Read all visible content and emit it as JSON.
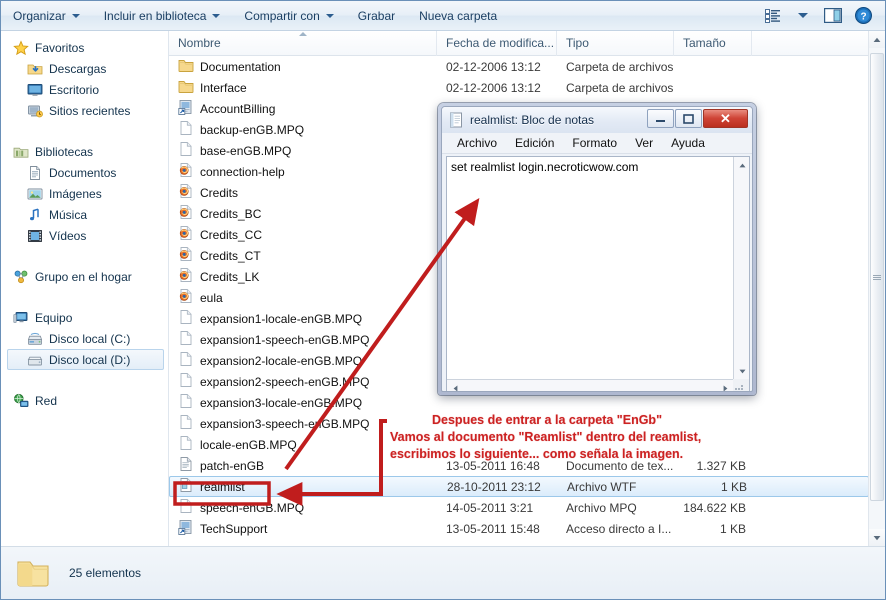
{
  "toolbar": {
    "items": [
      {
        "label": "Organizar",
        "caret": true,
        "name": "organize-button"
      },
      {
        "label": "Incluir en biblioteca",
        "caret": true,
        "name": "include-in-library-button"
      },
      {
        "label": "Compartir con",
        "caret": true,
        "name": "share-with-button"
      },
      {
        "label": "Grabar",
        "caret": false,
        "name": "burn-button"
      },
      {
        "label": "Nueva carpeta",
        "caret": false,
        "name": "new-folder-button"
      }
    ],
    "right_icons": [
      "view-options-icon",
      "chevron-down-icon",
      "preview-pane-icon",
      "help-icon"
    ]
  },
  "navpane": {
    "groups": [
      {
        "header": {
          "label": "Favoritos",
          "icon": "star-icon"
        },
        "items": [
          {
            "label": "Descargas",
            "icon": "downloads-folder-icon"
          },
          {
            "label": "Escritorio",
            "icon": "desktop-icon"
          },
          {
            "label": "Sitios recientes",
            "icon": "recent-places-icon"
          }
        ]
      },
      {
        "header": {
          "label": "Bibliotecas",
          "icon": "libraries-icon"
        },
        "items": [
          {
            "label": "Documentos",
            "icon": "documents-icon"
          },
          {
            "label": "Imágenes",
            "icon": "pictures-icon"
          },
          {
            "label": "Música",
            "icon": "music-icon"
          },
          {
            "label": "Vídeos",
            "icon": "videos-icon"
          }
        ]
      },
      {
        "header": {
          "label": "Grupo en el hogar",
          "icon": "homegroup-icon"
        },
        "items": []
      },
      {
        "header": {
          "label": "Equipo",
          "icon": "computer-icon"
        },
        "items": [
          {
            "label": "Disco local (C:)",
            "icon": "hard-disk-icon",
            "selected": false
          },
          {
            "label": "Disco local (D:)",
            "icon": "local-disk-icon",
            "selected": true
          }
        ]
      },
      {
        "header": {
          "label": "Red",
          "icon": "network-icon"
        },
        "items": []
      }
    ]
  },
  "columns": [
    {
      "label": "Nombre",
      "name": "column-header-name",
      "sorted": true
    },
    {
      "label": "Fecha de modifica...",
      "name": "column-header-date"
    },
    {
      "label": "Tipo",
      "name": "column-header-type"
    },
    {
      "label": "Tamaño",
      "name": "column-header-size"
    }
  ],
  "files": [
    {
      "name": "Documentation",
      "icon": "folder-icon",
      "date": "02-12-2006 13:12",
      "type": "Carpeta de archivos",
      "size": ""
    },
    {
      "name": "Interface",
      "icon": "folder-icon",
      "date": "02-12-2006 13:12",
      "type": "Carpeta de archivos",
      "size": ""
    },
    {
      "name": "AccountBilling",
      "icon": "shortcut-icon",
      "date": "",
      "type": "",
      "size": ""
    },
    {
      "name": "backup-enGB.MPQ",
      "icon": "blank-file-icon",
      "date": "",
      "type": "",
      "size": ""
    },
    {
      "name": "base-enGB.MPQ",
      "icon": "blank-file-icon",
      "date": "",
      "type": "",
      "size": ""
    },
    {
      "name": "connection-help",
      "icon": "firefox-html-icon",
      "date": "",
      "type": "",
      "size": ""
    },
    {
      "name": "Credits",
      "icon": "firefox-html-icon",
      "date": "",
      "type": "",
      "size": ""
    },
    {
      "name": "Credits_BC",
      "icon": "firefox-html-icon",
      "date": "",
      "type": "",
      "size": ""
    },
    {
      "name": "Credits_CC",
      "icon": "firefox-html-icon",
      "date": "",
      "type": "",
      "size": ""
    },
    {
      "name": "Credits_CT",
      "icon": "firefox-html-icon",
      "date": "",
      "type": "",
      "size": ""
    },
    {
      "name": "Credits_LK",
      "icon": "firefox-html-icon",
      "date": "",
      "type": "",
      "size": ""
    },
    {
      "name": "eula",
      "icon": "firefox-html-icon",
      "date": "",
      "type": "",
      "size": ""
    },
    {
      "name": "expansion1-locale-enGB.MPQ",
      "icon": "blank-file-icon",
      "date": "",
      "type": "",
      "size": ""
    },
    {
      "name": "expansion1-speech-enGB.MPQ",
      "icon": "blank-file-icon",
      "date": "",
      "type": "",
      "size": ""
    },
    {
      "name": "expansion2-locale-enGB.MPQ",
      "icon": "blank-file-icon",
      "date": "",
      "type": "",
      "size": ""
    },
    {
      "name": "expansion2-speech-enGB.MPQ",
      "icon": "blank-file-icon",
      "date": "",
      "type": "",
      "size": ""
    },
    {
      "name": "expansion3-locale-enGB.MPQ",
      "icon": "blank-file-icon",
      "date": "",
      "type": "",
      "size": ""
    },
    {
      "name": "expansion3-speech-enGB.MPQ",
      "icon": "blank-file-icon",
      "date": "",
      "type": "",
      "size": ""
    },
    {
      "name": "locale-enGB.MPQ",
      "icon": "blank-file-icon",
      "date": "",
      "type": "",
      "size": ""
    },
    {
      "name": "patch-enGB",
      "icon": "text-document-icon",
      "date": "13-05-2011 16:48",
      "type": "Documento de tex...",
      "size": "1.327 KB"
    },
    {
      "name": "realmlist",
      "icon": "wtf-file-icon",
      "date": "28-10-2011 23:12",
      "type": "Archivo WTF",
      "size": "1 KB",
      "selected": true
    },
    {
      "name": "speech-enGB.MPQ",
      "icon": "blank-file-icon",
      "date": "14-05-2011 3:21",
      "type": "Archivo MPQ",
      "size": "184.622 KB"
    },
    {
      "name": "TechSupport",
      "icon": "shortcut-icon",
      "date": "13-05-2011 15:48",
      "type": "Acceso directo a I...",
      "size": "1 KB"
    }
  ],
  "statusbar": {
    "icon": "folder-icon",
    "text": "25 elementos"
  },
  "notepad": {
    "title": "realmlist: Bloc de notas",
    "title_icon": "notepad-icon",
    "menu": [
      "Archivo",
      "Edición",
      "Formato",
      "Ver",
      "Ayuda"
    ],
    "content": "set realmlist login.necroticwow.com",
    "buttons": {
      "minimize": "–",
      "maximize": "□",
      "close": "✕"
    }
  },
  "annotation": {
    "line1": "Despues de entrar a la carpeta \"EnGb\"",
    "line2": "Vamos al documento \"Reamlist\" dentro del reamlist,",
    "line3": "escribimos lo siguiente... como señala la imagen.",
    "color": "#cc2222"
  }
}
